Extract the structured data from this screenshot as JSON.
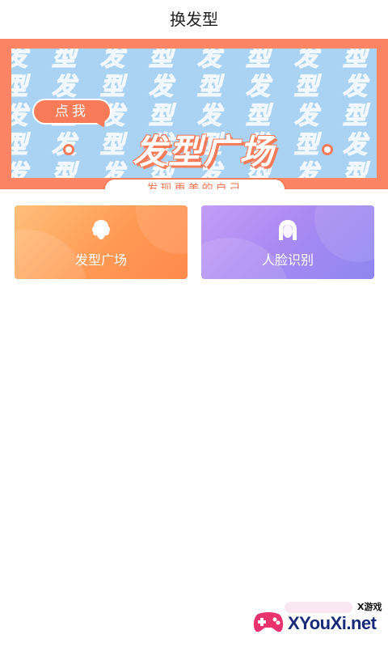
{
  "header": {
    "title": "换发型"
  },
  "banner": {
    "tap_label": "点我",
    "title": "发型广场",
    "subtitle": "发现更美的自己",
    "pattern_chars": [
      "发",
      "型",
      "发",
      "型",
      "发",
      "型",
      "发",
      "型"
    ]
  },
  "cards": [
    {
      "label": "发型广场",
      "icon": "hairstyle-icon",
      "color": "#ff9954"
    },
    {
      "label": "人脸识别",
      "icon": "face-icon",
      "color": "#a889f2"
    }
  ],
  "watermark": {
    "small": "X游戏",
    "text": "XYouXi.net"
  },
  "colors": {
    "accent": "#f77b58",
    "banner_bg": "#a9d2f3"
  }
}
